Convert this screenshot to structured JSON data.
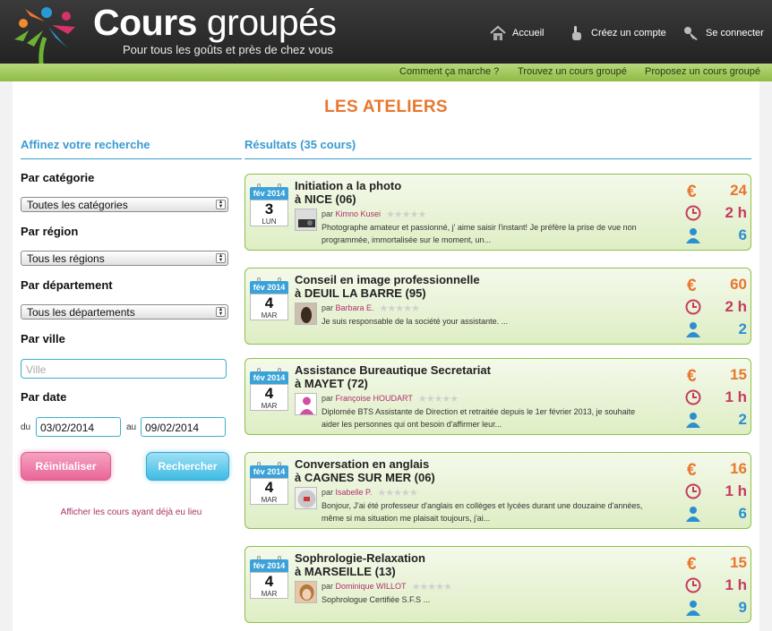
{
  "header": {
    "brand_bold": "Cours",
    "brand_light": "groupés",
    "tagline": "Pour tous les goûts et près de chez vous",
    "nav": [
      {
        "label": "Accueil",
        "icon": "home-icon"
      },
      {
        "label": "Créez un compte",
        "icon": "hand-pointer-icon"
      },
      {
        "label": "Se connecter",
        "icon": "key-icon"
      }
    ],
    "subnav": [
      "Comment ça marche ?",
      "Trouvez un cours groupé",
      "Proposez un cours groupé"
    ]
  },
  "page": {
    "title": "LES ATELIERS"
  },
  "sidebar": {
    "heading": "Affinez votre recherche",
    "category": {
      "label": "Par catégorie",
      "value": "Toutes les catégories"
    },
    "region": {
      "label": "Par région",
      "value": "Tous les régions"
    },
    "department": {
      "label": "Par département",
      "value": "Tous les départements"
    },
    "city": {
      "label": "Par ville",
      "placeholder": "Ville"
    },
    "date": {
      "label": "Par date",
      "from_label": "du",
      "from": "03/02/2014",
      "to_label": "au",
      "to": "09/02/2014"
    },
    "reset_label": "Réinitialiser",
    "search_label": "Rechercher",
    "past_link": "Afficher les cours ayant déjà eu lieu"
  },
  "results": {
    "heading": "Résultats (35 cours)",
    "items": [
      {
        "month": "fév 2014",
        "day": "3",
        "weekday": "LUN",
        "title": "Initiation a la photo",
        "city": "à NICE (06)",
        "by": "par",
        "author": "Kimno Kusei",
        "desc": "Photographe amateur et passionné, j' aime saisir l'instant! Je préfère la prise de vue non programmée, immortalisée sur le moment, un...",
        "price": "24",
        "duration": "2 h",
        "people": "6",
        "rating": 0
      },
      {
        "month": "fév 2014",
        "day": "4",
        "weekday": "MAR",
        "title": "Conseil en image professionnelle",
        "city": "à DEUIL LA BARRE (95)",
        "by": "par",
        "author": "Barbara E.",
        "desc": "Je suis responsable de la société your assistante. ...",
        "price": "60",
        "duration": "2 h",
        "people": "2",
        "rating": 0
      },
      {
        "month": "fév 2014",
        "day": "4",
        "weekday": "MAR",
        "title": "Assistance Bureautique Secretariat",
        "city": "à MAYET (72)",
        "by": "par",
        "author": "Françoise HOUDART",
        "desc": "Diplomée BTS Assistante de Direction et retraitée depuis le 1er février 2013, je souhaite aider les personnes qui ont besoin d'affirmer leur...",
        "price": "15",
        "duration": "1 h",
        "people": "2",
        "rating": 0
      },
      {
        "month": "fév 2014",
        "day": "4",
        "weekday": "MAR",
        "title": "Conversation en anglais",
        "city": "à CAGNES SUR MER (06)",
        "by": "par",
        "author": "Isabelle P.",
        "desc": "Bonjour, J'ai été professeur d'anglais en collèges et lycées durant une douzaine d'années, même si ma situation me plaisait toujours, j'ai...",
        "price": "16",
        "duration": "1 h",
        "people": "6",
        "rating": 0
      },
      {
        "month": "fév 2014",
        "day": "4",
        "weekday": "MAR",
        "title": "Sophrologie-Relaxation",
        "city": "à MARSEILLE (13)",
        "by": "par",
        "author": "Dominique WILLOT",
        "desc": "Sophrologue Certifiée S.F.S ...",
        "price": "15",
        "duration": "1 h",
        "people": "9",
        "rating": 0
      }
    ]
  },
  "colors": {
    "accent_orange": "#e8772e",
    "accent_blue": "#3a9bd1",
    "green": "#8fbb45",
    "pink": "#e96697"
  }
}
